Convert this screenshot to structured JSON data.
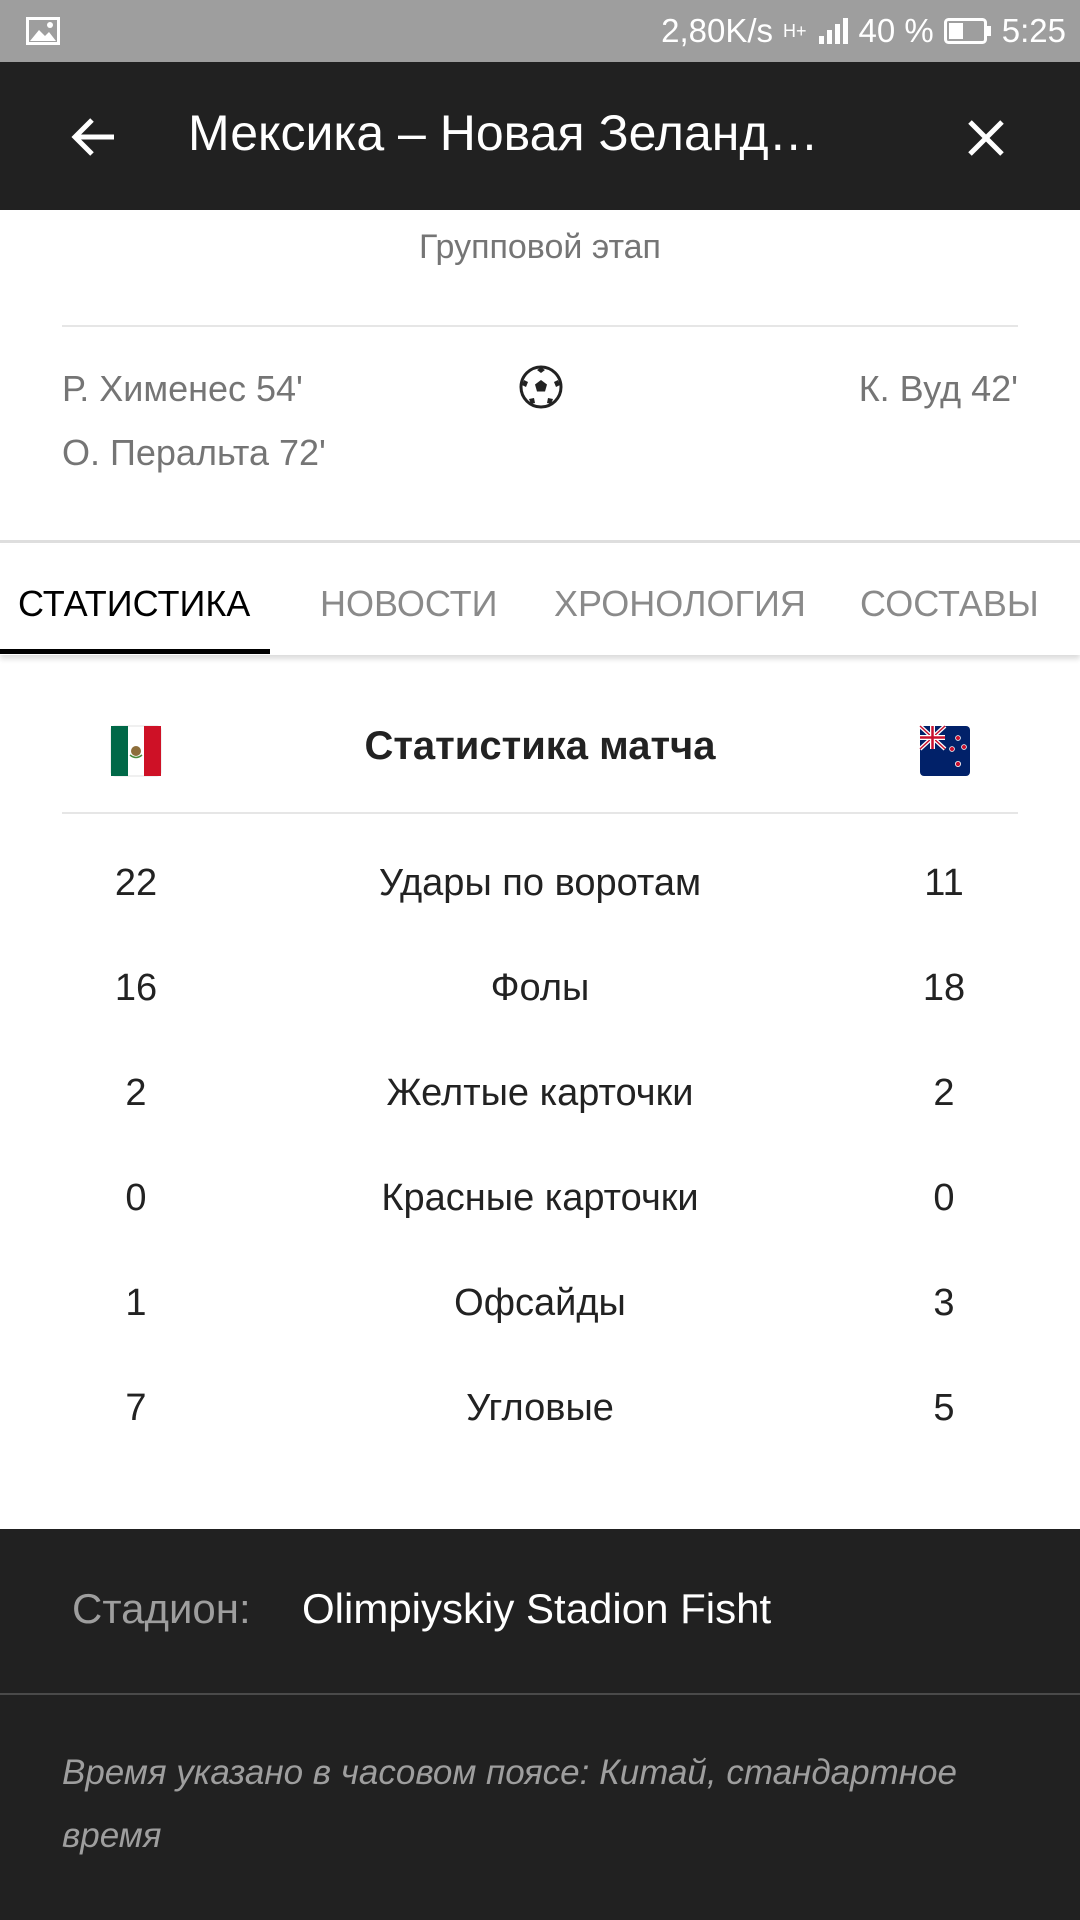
{
  "status_bar": {
    "speed": "2,80K/s",
    "network": "H+",
    "battery": "40 %",
    "time": "5:25",
    "icons": [
      "gallery-icon",
      "signal-icon",
      "battery-icon"
    ]
  },
  "app_bar": {
    "title": "Мексика – Новая Зеланд…",
    "icons": [
      "back-arrow-icon",
      "close-icon"
    ]
  },
  "match": {
    "stage": "Групповой этап",
    "home_scorers": [
      "Р. Хименес 54'",
      "О. Перальта 72'"
    ],
    "away_scorers": [
      "К. Вуд 42'"
    ],
    "ball_icon": "soccer-ball-icon"
  },
  "tabs": [
    {
      "label": "СТАТИСТИКА",
      "active": true
    },
    {
      "label": "НОВОСТИ",
      "active": false
    },
    {
      "label": "ХРОНОЛОГИЯ",
      "active": false
    },
    {
      "label": "СОСТАВЫ",
      "active": false
    }
  ],
  "stats": {
    "title": "Статистика матча",
    "home_flag": "mexico-flag-icon",
    "away_flag": "new-zealand-flag-icon",
    "rows": [
      {
        "home": "22",
        "label": "Удары по воротам",
        "away": "11"
      },
      {
        "home": "16",
        "label": "Фолы",
        "away": "18"
      },
      {
        "home": "2",
        "label": "Желтые карточки",
        "away": "2"
      },
      {
        "home": "0",
        "label": "Красные карточки",
        "away": "0"
      },
      {
        "home": "1",
        "label": "Офсайды",
        "away": "3"
      },
      {
        "home": "7",
        "label": "Угловые",
        "away": "5"
      }
    ]
  },
  "footer": {
    "stadium_label": "Стадион:",
    "stadium_value": "Olimpiyskiy Stadion Fisht",
    "timezone_note": "Время указано в часовом поясе: Китай, стандартное время"
  },
  "colors": {
    "app_bar": "#212121",
    "status_bar": "#9e9e9e",
    "active_tab": "#000000",
    "inactive_tab": "#8a8a8a"
  }
}
